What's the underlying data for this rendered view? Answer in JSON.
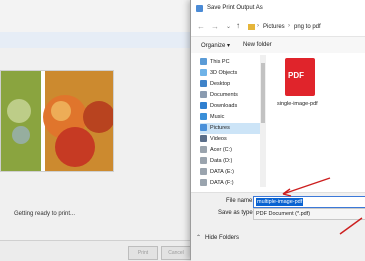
{
  "background_window": {
    "status_text": "Getting ready to print...",
    "print_button": "Print",
    "cancel_button": "Cancel"
  },
  "dialog": {
    "title": "Save Print Output As",
    "breadcrumb": [
      "Pictures",
      "png to pdf"
    ],
    "organize_label": "Organize ▾",
    "new_folder_label": "New folder",
    "nav_items": [
      {
        "label": "This PC",
        "icon": "computer-icon"
      },
      {
        "label": "3D Objects",
        "icon": "cube-icon"
      },
      {
        "label": "Desktop",
        "icon": "desktop-icon"
      },
      {
        "label": "Documents",
        "icon": "documents-icon"
      },
      {
        "label": "Downloads",
        "icon": "download-icon"
      },
      {
        "label": "Music",
        "icon": "music-icon"
      },
      {
        "label": "Pictures",
        "icon": "pictures-icon"
      },
      {
        "label": "Videos",
        "icon": "video-icon"
      },
      {
        "label": "Acer (C:)",
        "icon": "drive-icon"
      },
      {
        "label": "Data (D:)",
        "icon": "drive-icon"
      },
      {
        "label": "DATA (E:)",
        "icon": "drive-icon"
      },
      {
        "label": "DATA (F:)",
        "icon": "drive-icon"
      }
    ],
    "file_item": {
      "name": "single-image-pdf",
      "badge": "PDF"
    },
    "file_name_label": "File name:",
    "file_name_value": "multiple-image-pdf",
    "save_type_label": "Save as type:",
    "save_type_value": "PDF Document (*.pdf)",
    "hide_folders_label": "Hide Folders",
    "colors": {
      "accent": "#0a63d1",
      "pdf_red": "#e0242b",
      "selection": "#cce4f7",
      "arrow": "#cc1f1f"
    }
  }
}
